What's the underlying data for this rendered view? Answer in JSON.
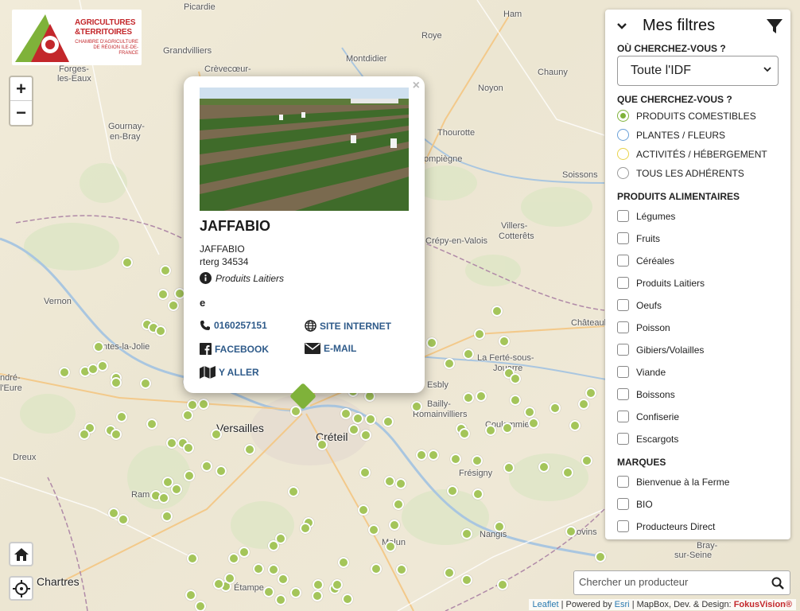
{
  "logo": {
    "line1": "AGRICULTURES",
    "line2": "&TERRITOIRES",
    "line3": "CHAMBRE D'AGRICULTURE DE RÉGION ILE-DE-FRANCE"
  },
  "map_controls": {
    "zoom_in": "+",
    "zoom_out": "−",
    "home_icon": "home-icon",
    "locate_icon": "crosshair-icon"
  },
  "places": {
    "picardie": "Picardie",
    "grandvilliers": "Grandvilliers",
    "crevecoeur": "Crèvecœur-",
    "montdidier": "Montdidier",
    "roye": "Roye",
    "ham": "Ham",
    "chauny": "Chauny",
    "noyon": "Noyon",
    "forges": "Forges-",
    "forges2": "les-Eaux",
    "gournay": "Gournay-",
    "gournay2": "en-Bray",
    "thourotte": "Thourotte",
    "compiegne": "ompiègne",
    "soissons": "Soissons",
    "villers": "Villers-",
    "villers2": "Cotterêts",
    "crepy": "Crépy-en-Valois",
    "vernon": "Vernon",
    "mantes": "ntes-la-Jolie",
    "chateau": "Châteaul",
    "laferte": "La Ferté-sous-",
    "laferte2": "Jouarre",
    "esbly": "Esbly",
    "bailly": "Bailly-",
    "bailly2": "Romainvilliers",
    "coulommiers": "Coulommiers",
    "andre": "ndré-",
    "andre2": "l'Eure",
    "versailles": "Versailles",
    "creteil": "Créteil",
    "dreux": "Dreux",
    "fresigny": "Frésigny",
    "rambouillet": "Ram",
    "nangis": "Nangis",
    "melun": "Melun",
    "provins": "Provins",
    "bray": "Bray-",
    "bray2": "sur-Seine",
    "chartres": "Chartres",
    "etampes": "Étampe"
  },
  "popup": {
    "close": "×",
    "title": "JAFFABIO",
    "line1": "JAFFABIO",
    "line2": "rterg 34534",
    "category": "Produits Laitiers",
    "extra": "e",
    "phone": "0160257151",
    "website": "SITE INTERNET",
    "facebook": "FACEBOOK",
    "email": "E-MAIL",
    "directions": "Y ALLER"
  },
  "filters": {
    "title": "Mes filtres",
    "where_label": "OÙ CHERCHEZ-VOUS ?",
    "where_value": "Toute l'IDF",
    "what_label": "QUE CHERCHEZ-VOUS ?",
    "what_options": [
      {
        "label": "PRODUITS COMESTIBLES",
        "selected": true,
        "color": "#7fb23a"
      },
      {
        "label": "PLANTES / FLEURS",
        "selected": false,
        "color": "#6aa0d8"
      },
      {
        "label": "ACTIVITÉS / HÉBERGEMENT",
        "selected": false,
        "color": "#e8d34a"
      },
      {
        "label": "TOUS LES ADHÉRENTS",
        "selected": false,
        "color": "#999999"
      }
    ],
    "food_label": "PRODUITS ALIMENTAIRES",
    "food": [
      "Légumes",
      "Fruits",
      "Céréales",
      "Produits Laitiers",
      "Oeufs",
      "Poisson",
      "Gibiers/Volailles",
      "Viande",
      "Boissons",
      "Confiserie",
      "Escargots"
    ],
    "brands_label": "MARQUES",
    "brands": [
      "Bienvenue à la Ferme",
      "BIO",
      "Producteurs Direct"
    ]
  },
  "search": {
    "placeholder": "Chercher un producteur"
  },
  "attribution": {
    "leaflet": "Leaflet",
    "powered": "| Powered by",
    "esri": "Esri",
    "rest": "| MapBox, Dev. & Design:",
    "fokus": "FokusVision®"
  },
  "colors": {
    "marker": "#a4c55a",
    "accent": "#7fb23a",
    "link": "#2f5b8a",
    "brand_red": "#c3272b"
  }
}
